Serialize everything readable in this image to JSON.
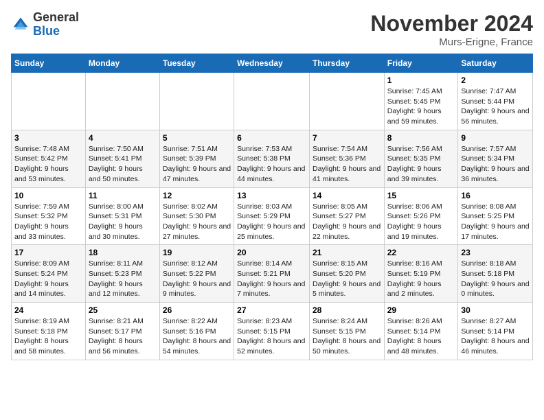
{
  "header": {
    "logo_general": "General",
    "logo_blue": "Blue",
    "month": "November 2024",
    "location": "Murs-Erigne, France"
  },
  "weekdays": [
    "Sunday",
    "Monday",
    "Tuesday",
    "Wednesday",
    "Thursday",
    "Friday",
    "Saturday"
  ],
  "weeks": [
    [
      null,
      null,
      null,
      null,
      null,
      {
        "day": 1,
        "sunrise": "7:45 AM",
        "sunset": "5:45 PM",
        "daylight": "9 hours and 59 minutes."
      },
      {
        "day": 2,
        "sunrise": "7:47 AM",
        "sunset": "5:44 PM",
        "daylight": "9 hours and 56 minutes."
      }
    ],
    [
      {
        "day": 3,
        "sunrise": "7:48 AM",
        "sunset": "5:42 PM",
        "daylight": "9 hours and 53 minutes."
      },
      {
        "day": 4,
        "sunrise": "7:50 AM",
        "sunset": "5:41 PM",
        "daylight": "9 hours and 50 minutes."
      },
      {
        "day": 5,
        "sunrise": "7:51 AM",
        "sunset": "5:39 PM",
        "daylight": "9 hours and 47 minutes."
      },
      {
        "day": 6,
        "sunrise": "7:53 AM",
        "sunset": "5:38 PM",
        "daylight": "9 hours and 44 minutes."
      },
      {
        "day": 7,
        "sunrise": "7:54 AM",
        "sunset": "5:36 PM",
        "daylight": "9 hours and 41 minutes."
      },
      {
        "day": 8,
        "sunrise": "7:56 AM",
        "sunset": "5:35 PM",
        "daylight": "9 hours and 39 minutes."
      },
      {
        "day": 9,
        "sunrise": "7:57 AM",
        "sunset": "5:34 PM",
        "daylight": "9 hours and 36 minutes."
      }
    ],
    [
      {
        "day": 10,
        "sunrise": "7:59 AM",
        "sunset": "5:32 PM",
        "daylight": "9 hours and 33 minutes."
      },
      {
        "day": 11,
        "sunrise": "8:00 AM",
        "sunset": "5:31 PM",
        "daylight": "9 hours and 30 minutes."
      },
      {
        "day": 12,
        "sunrise": "8:02 AM",
        "sunset": "5:30 PM",
        "daylight": "9 hours and 27 minutes."
      },
      {
        "day": 13,
        "sunrise": "8:03 AM",
        "sunset": "5:29 PM",
        "daylight": "9 hours and 25 minutes."
      },
      {
        "day": 14,
        "sunrise": "8:05 AM",
        "sunset": "5:27 PM",
        "daylight": "9 hours and 22 minutes."
      },
      {
        "day": 15,
        "sunrise": "8:06 AM",
        "sunset": "5:26 PM",
        "daylight": "9 hours and 19 minutes."
      },
      {
        "day": 16,
        "sunrise": "8:08 AM",
        "sunset": "5:25 PM",
        "daylight": "9 hours and 17 minutes."
      }
    ],
    [
      {
        "day": 17,
        "sunrise": "8:09 AM",
        "sunset": "5:24 PM",
        "daylight": "9 hours and 14 minutes."
      },
      {
        "day": 18,
        "sunrise": "8:11 AM",
        "sunset": "5:23 PM",
        "daylight": "9 hours and 12 minutes."
      },
      {
        "day": 19,
        "sunrise": "8:12 AM",
        "sunset": "5:22 PM",
        "daylight": "9 hours and 9 minutes."
      },
      {
        "day": 20,
        "sunrise": "8:14 AM",
        "sunset": "5:21 PM",
        "daylight": "9 hours and 7 minutes."
      },
      {
        "day": 21,
        "sunrise": "8:15 AM",
        "sunset": "5:20 PM",
        "daylight": "9 hours and 5 minutes."
      },
      {
        "day": 22,
        "sunrise": "8:16 AM",
        "sunset": "5:19 PM",
        "daylight": "9 hours and 2 minutes."
      },
      {
        "day": 23,
        "sunrise": "8:18 AM",
        "sunset": "5:18 PM",
        "daylight": "9 hours and 0 minutes."
      }
    ],
    [
      {
        "day": 24,
        "sunrise": "8:19 AM",
        "sunset": "5:18 PM",
        "daylight": "8 hours and 58 minutes."
      },
      {
        "day": 25,
        "sunrise": "8:21 AM",
        "sunset": "5:17 PM",
        "daylight": "8 hours and 56 minutes."
      },
      {
        "day": 26,
        "sunrise": "8:22 AM",
        "sunset": "5:16 PM",
        "daylight": "8 hours and 54 minutes."
      },
      {
        "day": 27,
        "sunrise": "8:23 AM",
        "sunset": "5:15 PM",
        "daylight": "8 hours and 52 minutes."
      },
      {
        "day": 28,
        "sunrise": "8:24 AM",
        "sunset": "5:15 PM",
        "daylight": "8 hours and 50 minutes."
      },
      {
        "day": 29,
        "sunrise": "8:26 AM",
        "sunset": "5:14 PM",
        "daylight": "8 hours and 48 minutes."
      },
      {
        "day": 30,
        "sunrise": "8:27 AM",
        "sunset": "5:14 PM",
        "daylight": "8 hours and 46 minutes."
      }
    ]
  ]
}
